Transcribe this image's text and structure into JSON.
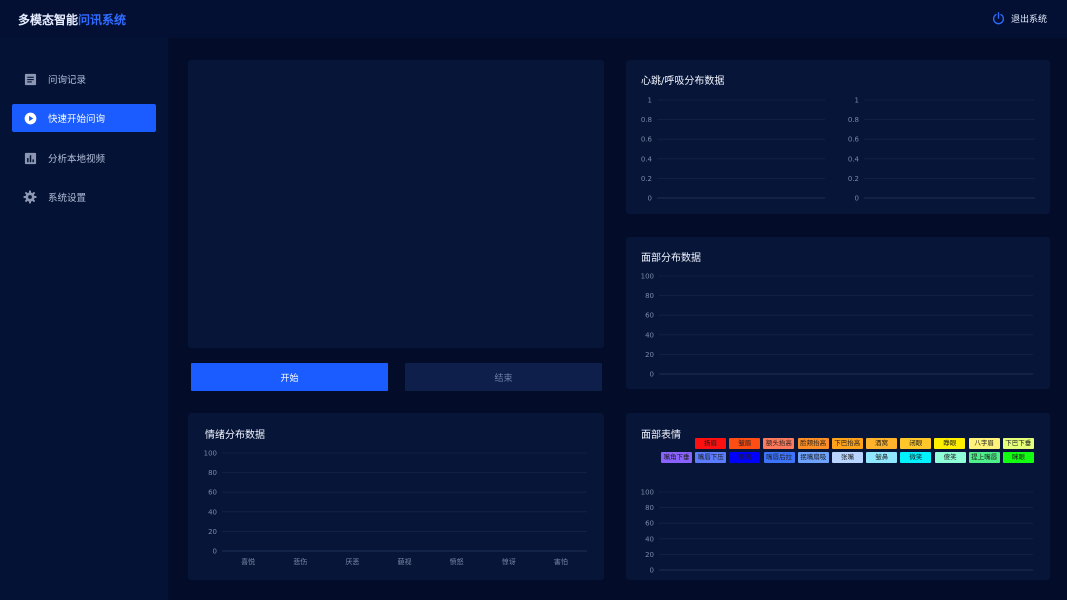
{
  "header": {
    "brand_prefix": "多模态智能",
    "brand_highlight": "问讯系统",
    "logout_label": "退出系统"
  },
  "sidebar": {
    "items": [
      {
        "label": "问询记录",
        "icon": "list-icon",
        "active": false
      },
      {
        "label": "快速开始问询",
        "icon": "play-icon",
        "active": true
      },
      {
        "label": "分析本地视频",
        "icon": "bar-chart-icon",
        "active": false
      },
      {
        "label": "系统设置",
        "icon": "gear-icon",
        "active": false
      }
    ]
  },
  "controls": {
    "start_label": "开始",
    "end_label": "结束"
  },
  "panels": {
    "heart_title": "心跳/呼吸分布数据",
    "face_title": "面部分布数据",
    "emotion_title": "情绪分布数据",
    "expression_title": "面部表情"
  },
  "colors": {
    "accent": "#1a5cff",
    "brand_highlight": "#2f6bff",
    "background": "#030d2a",
    "panel": "#061538"
  },
  "chart_data": [
    {
      "type": "line",
      "title": "心跳/呼吸分布数据",
      "ylim": [
        0,
        1
      ],
      "yticks": [
        "0",
        "0.2",
        "0.4",
        "0.6",
        "0.8",
        "1"
      ],
      "series": []
    },
    {
      "type": "line",
      "ylim": [
        0,
        1
      ],
      "yticks": [
        "0",
        "0.2",
        "0.4",
        "0.6",
        "0.8",
        "1"
      ],
      "series": []
    },
    {
      "type": "line",
      "title": "面部分布数据",
      "ylim": [
        0,
        100
      ],
      "yticks": [
        "0",
        "20",
        "40",
        "60",
        "80",
        "100"
      ],
      "series": []
    },
    {
      "type": "bar",
      "title": "情绪分布数据",
      "ylim": [
        0,
        100
      ],
      "yticks": [
        "0",
        "20",
        "40",
        "60",
        "80",
        "100"
      ],
      "categories": [
        "喜悦",
        "悲伤",
        "厌恶",
        "藐视",
        "愤怒",
        "惊讶",
        "害怕"
      ],
      "values": []
    },
    {
      "type": "line",
      "title": "面部表情",
      "ylim": [
        0,
        100
      ],
      "yticks": [
        "0",
        "20",
        "40",
        "60",
        "80",
        "100"
      ],
      "legend": [
        {
          "name": "扬眉",
          "color": "#ff1010"
        },
        {
          "name": "皱眉",
          "color": "#ff4e14"
        },
        {
          "name": "额头抬高",
          "color": "#ff7a5c"
        },
        {
          "name": "脸颊抬高",
          "color": "#ff8f24"
        },
        {
          "name": "下巴抬高",
          "color": "#ffa41a"
        },
        {
          "name": "酒窝",
          "color": "#ffb22b"
        },
        {
          "name": "闭眼",
          "color": "#ffc72a"
        },
        {
          "name": "睁眼",
          "color": "#ffee00"
        },
        {
          "name": "八字眉",
          "color": "#fff27a"
        },
        {
          "name": "下巴下垂",
          "color": "#e4ff78"
        },
        {
          "name": "嘴角下垂",
          "color": "#8a63ff"
        },
        {
          "name": "嘴唇下压",
          "color": "#5b7cff"
        },
        {
          "name": "噘嘴",
          "color": "#0000ff"
        },
        {
          "name": "嘴唇后拉",
          "color": "#3d74ff"
        },
        {
          "name": "抿嘴扇吸",
          "color": "#6ea2ff"
        },
        {
          "name": "张嘴",
          "color": "#b8d4ff"
        },
        {
          "name": "皱鼻",
          "color": "#90e8ff"
        },
        {
          "name": "微笑",
          "color": "#00f2ff"
        },
        {
          "name": "傻笑",
          "color": "#8fffd8"
        },
        {
          "name": "提上嘴唇",
          "color": "#4df08a"
        },
        {
          "name": "眯眼",
          "color": "#12ff12"
        }
      ],
      "series": []
    }
  ]
}
